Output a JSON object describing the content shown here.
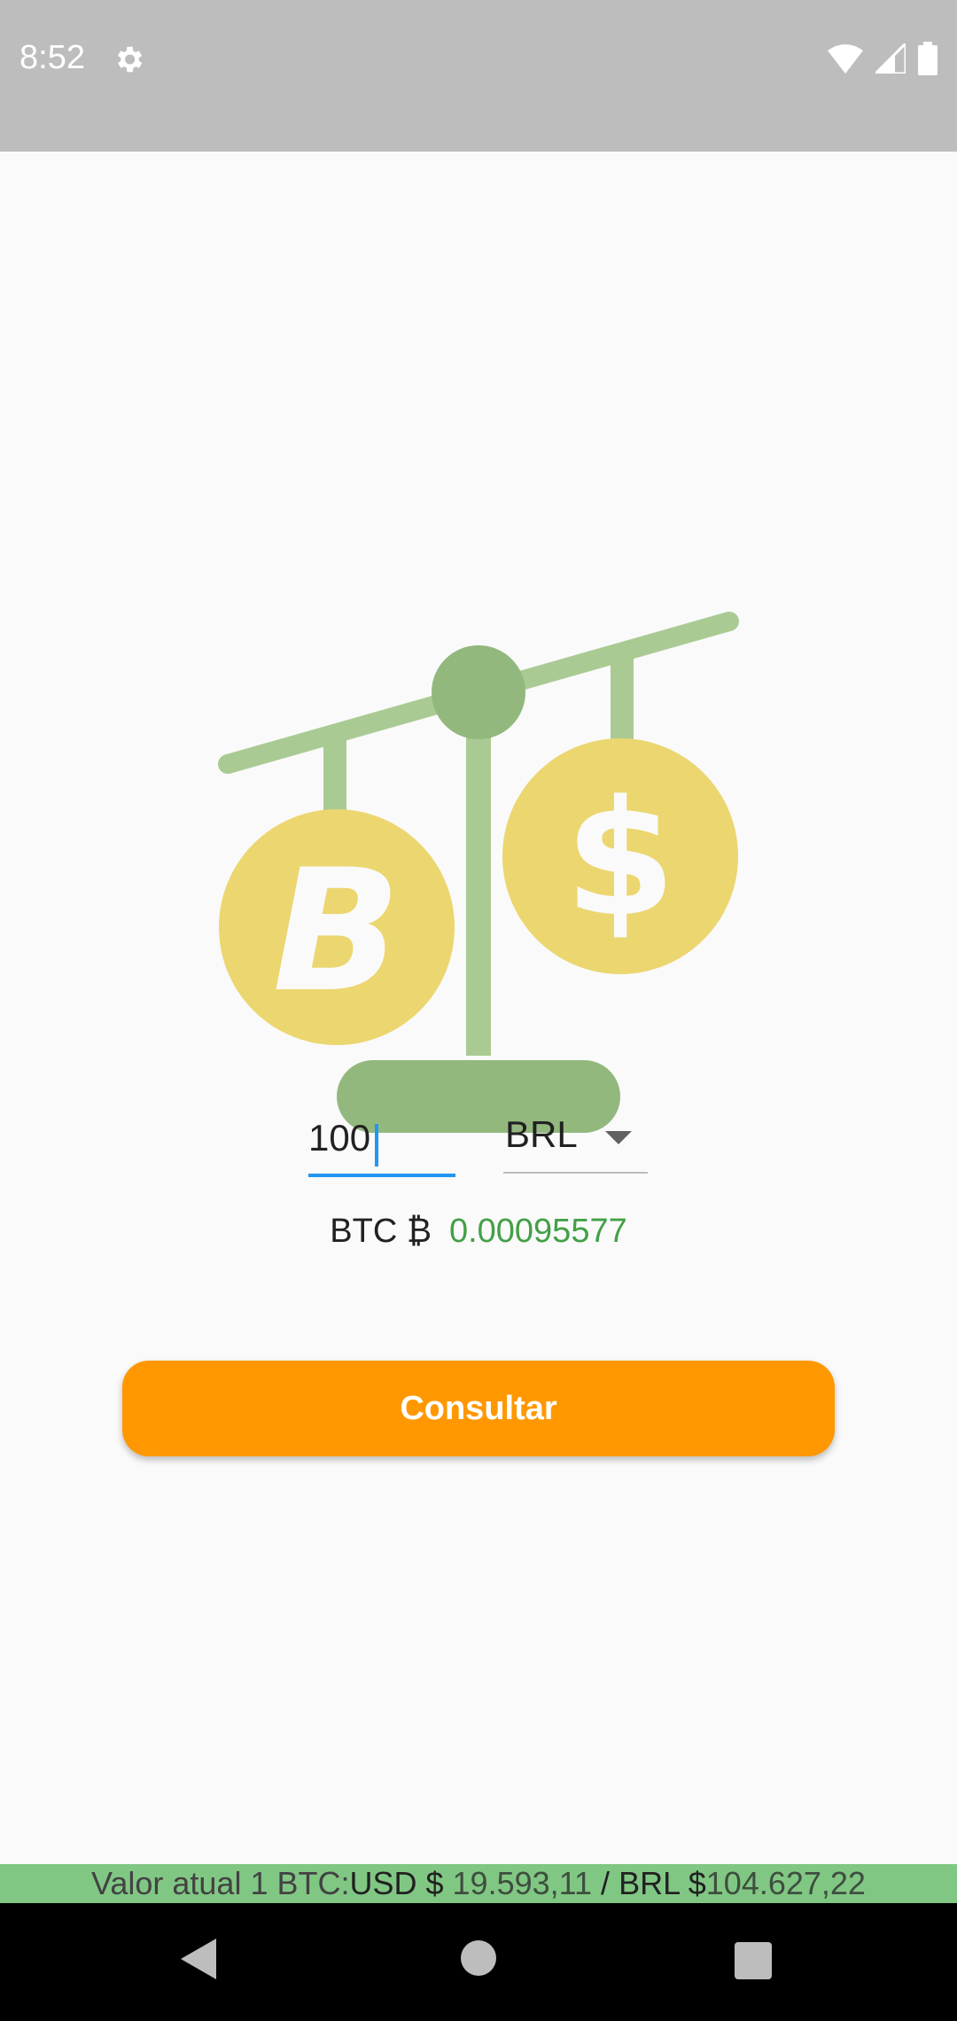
{
  "status_bar": {
    "time": "8:52",
    "icons": [
      "settings-icon",
      "wifi-icon",
      "signal-icon",
      "battery-icon"
    ]
  },
  "illustration": {
    "icon": "bitcoin-dollar-balance-scale",
    "colors": {
      "scale": "#a9cb93",
      "scale_dark": "#93b87e",
      "coin": "#ecd670"
    }
  },
  "form": {
    "amount_value": "100",
    "currency_selected": "BRL",
    "result_label": "BTC ₿",
    "result_value": "0.00095577"
  },
  "button": {
    "label": "Consultar"
  },
  "ticker": {
    "label": "Valor atual 1 BTC:",
    "usd_prefix": "USD $",
    "usd_value": "19.593,11",
    "separator": "/",
    "brl_prefix": "BRL $",
    "brl_value": "104.627,22"
  },
  "colors": {
    "accent": "#ff9800",
    "input_focus": "#2196f3",
    "result_green": "#43a047",
    "ticker_bg": "#81c784"
  }
}
